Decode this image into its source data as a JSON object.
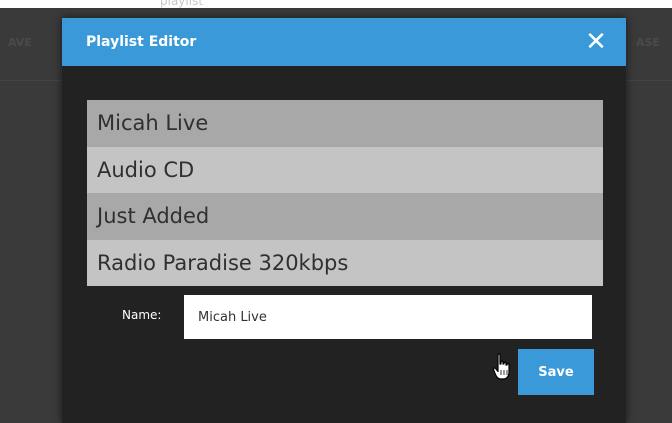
{
  "background": {
    "faint_top_title": "playlist",
    "left_text": "AVE",
    "right_text": "ASE"
  },
  "modal": {
    "title": "Playlist Editor",
    "close_symbol": "✕",
    "header_color": "#3a9ad9"
  },
  "playlists": [
    "Micah Live",
    "Audio CD",
    "Just Added",
    "Radio Paradise 320kbps"
  ],
  "form": {
    "name_label": "Name:",
    "name_value": "Micah Live"
  },
  "actions": {
    "save_label": "Save"
  },
  "icons": {
    "close": "close-icon",
    "cursor": "hand-pointer-icon"
  }
}
